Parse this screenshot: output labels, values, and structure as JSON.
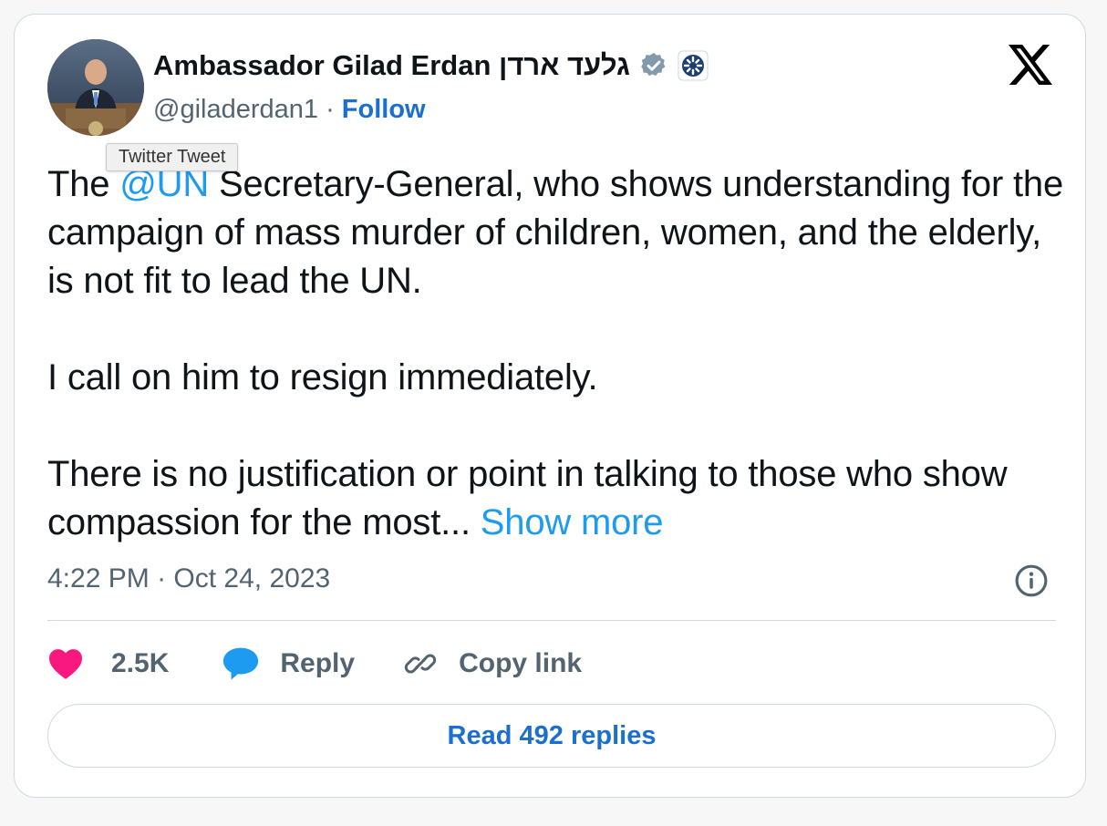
{
  "author": {
    "name": "Ambassador Gilad Erdan גלעד ארדן",
    "handle": "@giladerdan1",
    "separator": "·",
    "follow_label": "Follow"
  },
  "tooltip": "Twitter Tweet",
  "tweet": {
    "line1_prefix": "The ",
    "mention": "@UN",
    "line1_rest": " Secretary-General, who shows understanding for the campaign of mass murder of children, women, and the elderly, is not fit to lead the UN.",
    "paragraph2": "I call on him to resign immediately.",
    "paragraph3": "There is no justification or point in talking to those who show compassion for the most... ",
    "show_more": "Show more"
  },
  "meta": {
    "time": "4:22 PM",
    "separator": "·",
    "date": "Oct 24, 2023"
  },
  "actions": {
    "likes": "2.5K",
    "reply_label": "Reply",
    "copy_label": "Copy link"
  },
  "read_replies_label": "Read 492 replies",
  "icons": {
    "platform_logo": "x-logo-icon",
    "verified": "verified-badge-icon",
    "affiliation": "government-affiliation-icon",
    "info": "info-icon",
    "like": "heart-icon",
    "reply": "speech-bubble-icon",
    "copy": "link-icon"
  },
  "colors": {
    "link": "#1d9bf0",
    "follow": "#1d6fce",
    "heart": "#f91880",
    "reply_bubble": "#1d9bf0",
    "muted": "#536471"
  }
}
